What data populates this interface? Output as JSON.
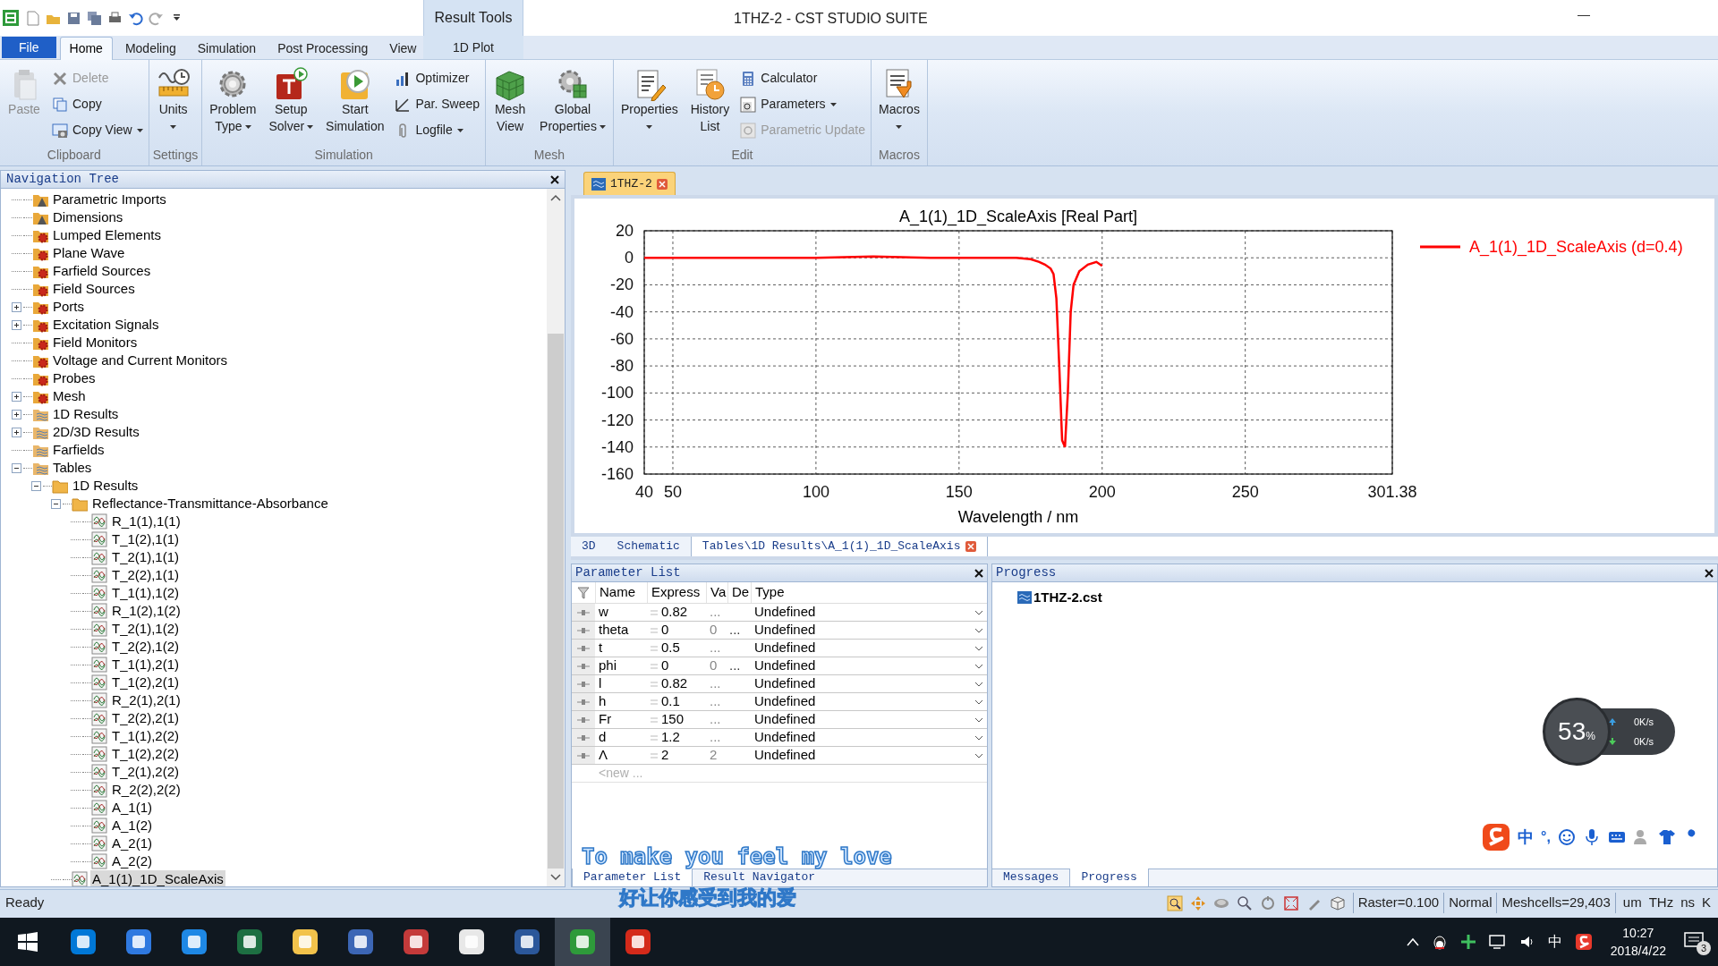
{
  "window": {
    "title": "1THZ-2 - CST STUDIO SUITE",
    "context_tab": "Result Tools",
    "minimize": "—"
  },
  "ribbon_tabs": [
    {
      "label": "File",
      "selected": false,
      "kind": "file"
    },
    {
      "label": "Home",
      "selected": true,
      "kind": "tab"
    },
    {
      "label": "Modeling",
      "selected": false,
      "kind": "tab"
    },
    {
      "label": "Simulation",
      "selected": false,
      "kind": "tab"
    },
    {
      "label": "Post Processing",
      "selected": false,
      "kind": "tab"
    },
    {
      "label": "View",
      "selected": false,
      "kind": "tab"
    },
    {
      "label": "1D Plot",
      "selected": false,
      "kind": "context"
    }
  ],
  "ribbon_groups": [
    {
      "label": "Clipboard",
      "items": [
        {
          "kind": "large",
          "lines": [
            "Paste"
          ],
          "disabled": true,
          "dropdown": false
        },
        {
          "kind": "stack",
          "items": [
            {
              "label": "Delete",
              "disabled": true,
              "dropdown": false
            },
            {
              "label": "Copy",
              "disabled": false,
              "dropdown": false
            },
            {
              "label": "Copy View",
              "disabled": false,
              "dropdown": true
            }
          ]
        }
      ]
    },
    {
      "label": "Settings",
      "items": [
        {
          "kind": "large",
          "lines": [
            "Units"
          ],
          "disabled": false,
          "dropdown": true
        }
      ]
    },
    {
      "label": "Simulation",
      "items": [
        {
          "kind": "large",
          "lines": [
            "Problem",
            "Type"
          ],
          "disabled": false,
          "dropdown": true
        },
        {
          "kind": "large",
          "lines": [
            "Setup",
            "Solver"
          ],
          "disabled": false,
          "dropdown": true
        },
        {
          "kind": "large",
          "lines": [
            "Start",
            "Simulation"
          ],
          "disabled": false,
          "dropdown": false
        },
        {
          "kind": "stack",
          "items": [
            {
              "label": "Optimizer",
              "disabled": false,
              "dropdown": false
            },
            {
              "label": "Par. Sweep",
              "disabled": false,
              "dropdown": false
            },
            {
              "label": "Logfile",
              "disabled": false,
              "dropdown": true
            }
          ]
        }
      ]
    },
    {
      "label": "Mesh",
      "items": [
        {
          "kind": "large",
          "lines": [
            "Mesh",
            "View"
          ],
          "disabled": false,
          "dropdown": false
        },
        {
          "kind": "large",
          "lines": [
            "Global",
            "Properties"
          ],
          "disabled": false,
          "dropdown": true
        }
      ]
    },
    {
      "label": "Edit",
      "items": [
        {
          "kind": "large",
          "lines": [
            "Properties"
          ],
          "disabled": false,
          "dropdown": true
        },
        {
          "kind": "large",
          "lines": [
            "History",
            "List"
          ],
          "disabled": false,
          "dropdown": false
        },
        {
          "kind": "stack",
          "items": [
            {
              "label": "Calculator",
              "disabled": false,
              "dropdown": false
            },
            {
              "label": "Parameters",
              "disabled": false,
              "dropdown": true
            },
            {
              "label": "Parametric Update",
              "disabled": true,
              "dropdown": false
            }
          ]
        }
      ]
    },
    {
      "label": "Macros",
      "items": [
        {
          "kind": "large",
          "lines": [
            "Macros"
          ],
          "disabled": false,
          "dropdown": true
        }
      ]
    }
  ],
  "navigation_tree": {
    "title": "Navigation Tree",
    "items": [
      {
        "label": "Parametric Imports",
        "kind": "parameter",
        "selected": false
      },
      {
        "label": "Dimensions",
        "kind": "parameter",
        "selected": false
      },
      {
        "label": "Lumped Elements",
        "kind": "component",
        "selected": false
      },
      {
        "label": "Plane Wave",
        "kind": "component",
        "selected": false
      },
      {
        "label": "Farfield Sources",
        "kind": "component",
        "selected": false
      },
      {
        "label": "Field Sources",
        "kind": "component",
        "selected": false
      },
      {
        "label": "Ports",
        "kind": "component",
        "selected": false,
        "expanded": false
      },
      {
        "label": "Excitation Signals",
        "kind": "component",
        "selected": false,
        "expanded": false
      },
      {
        "label": "Field Monitors",
        "kind": "component",
        "selected": false
      },
      {
        "label": "Voltage and Current Monitors",
        "kind": "component",
        "selected": false
      },
      {
        "label": "Probes",
        "kind": "component",
        "selected": false
      },
      {
        "label": "Mesh",
        "kind": "component",
        "selected": false,
        "expanded": false
      },
      {
        "label": "1D Results",
        "kind": "result",
        "selected": false,
        "expanded": false
      },
      {
        "label": "2D/3D Results",
        "kind": "result",
        "selected": false,
        "expanded": false
      },
      {
        "label": "Farfields",
        "kind": "result",
        "selected": false
      },
      {
        "label": "Tables",
        "kind": "result",
        "selected": false,
        "expanded": true,
        "children": [
          {
            "label": "1D Results",
            "kind": "folder",
            "selected": false,
            "expanded": true,
            "children": [
              {
                "label": "Reflectance-Transmittance-Absorbance",
                "kind": "folder",
                "selected": false,
                "expanded": true,
                "children": [
                  {
                    "label": "R_1(1),1(1)",
                    "kind": "curve",
                    "selected": false
                  },
                  {
                    "label": "T_1(2),1(1)",
                    "kind": "curve",
                    "selected": false
                  },
                  {
                    "label": "T_2(1),1(1)",
                    "kind": "curve",
                    "selected": false
                  },
                  {
                    "label": "T_2(2),1(1)",
                    "kind": "curve",
                    "selected": false
                  },
                  {
                    "label": "T_1(1),1(2)",
                    "kind": "curve",
                    "selected": false
                  },
                  {
                    "label": "R_1(2),1(2)",
                    "kind": "curve",
                    "selected": false
                  },
                  {
                    "label": "T_2(1),1(2)",
                    "kind": "curve",
                    "selected": false
                  },
                  {
                    "label": "T_2(2),1(2)",
                    "kind": "curve",
                    "selected": false
                  },
                  {
                    "label": "T_1(1),2(1)",
                    "kind": "curve",
                    "selected": false
                  },
                  {
                    "label": "T_1(2),2(1)",
                    "kind": "curve",
                    "selected": false
                  },
                  {
                    "label": "R_2(1),2(1)",
                    "kind": "curve",
                    "selected": false
                  },
                  {
                    "label": "T_2(2),2(1)",
                    "kind": "curve",
                    "selected": false
                  },
                  {
                    "label": "T_1(1),2(2)",
                    "kind": "curve",
                    "selected": false
                  },
                  {
                    "label": "T_1(2),2(2)",
                    "kind": "curve",
                    "selected": false
                  },
                  {
                    "label": "T_2(1),2(2)",
                    "kind": "curve",
                    "selected": false
                  },
                  {
                    "label": "R_2(2),2(2)",
                    "kind": "curve",
                    "selected": false
                  },
                  {
                    "label": "A_1(1)",
                    "kind": "curve",
                    "selected": false
                  },
                  {
                    "label": "A_1(2)",
                    "kind": "curve",
                    "selected": false
                  },
                  {
                    "label": "A_2(1)",
                    "kind": "curve",
                    "selected": false
                  },
                  {
                    "label": "A_2(2)",
                    "kind": "curve",
                    "selected": false
                  }
                ]
              },
              {
                "label": "A_1(1)_1D_ScaleAxis",
                "kind": "curve",
                "selected": true
              }
            ]
          }
        ]
      }
    ]
  },
  "document_tab": {
    "label": "1THZ-2"
  },
  "plot": {
    "chart_data": {
      "type": "line",
      "title": "A_1(1)_1D_ScaleAxis [Real Part]",
      "xlabel": "Wavelength / nm",
      "x": [
        40,
        60,
        80,
        100,
        120,
        140,
        160,
        170,
        175,
        178,
        180,
        182,
        183,
        184,
        185,
        186,
        187,
        188,
        189,
        190,
        192,
        195,
        198,
        200
      ],
      "series": [
        {
          "name": "A_1(1)_1D_ScaleAxis (d=0.4)",
          "color": "#ff0000",
          "values": [
            0,
            0,
            0,
            0,
            1,
            0,
            0,
            0,
            -1,
            -3,
            -5,
            -8,
            -12,
            -30,
            -80,
            -135,
            -140,
            -100,
            -40,
            -20,
            -10,
            -5,
            -3,
            -6
          ]
        }
      ],
      "xlim": [
        40,
        301.38
      ],
      "ylim": [
        -160,
        20
      ],
      "xticks": [
        40,
        50,
        100,
        150,
        200,
        250,
        301.38
      ],
      "yticks": [
        20,
        0,
        -20,
        -40,
        -60,
        -80,
        -100,
        -120,
        -140,
        -160
      ],
      "grid": true
    }
  },
  "view_tabs": [
    {
      "label": "3D",
      "selected": false,
      "closable": false
    },
    {
      "label": "Schematic",
      "selected": false,
      "closable": false
    },
    {
      "label": "Tables\\1D Results\\A_1(1)_1D_ScaleAxis",
      "selected": true,
      "closable": true
    }
  ],
  "parameter_list": {
    "title": "Parameter List",
    "columns": [
      "Name",
      "Express",
      "Va",
      "De",
      "Type"
    ],
    "rows": [
      {
        "name": "w",
        "expression": "0.82",
        "value": "...",
        "type": "Undefined"
      },
      {
        "name": "theta",
        "expression": "0",
        "value": "0",
        "description": "...",
        "type": "Undefined"
      },
      {
        "name": "t",
        "expression": "0.5",
        "value": "...",
        "type": "Undefined"
      },
      {
        "name": "phi",
        "expression": "0",
        "value": "0",
        "description": "...",
        "type": "Undefined"
      },
      {
        "name": "l",
        "expression": "0.82",
        "value": "...",
        "type": "Undefined"
      },
      {
        "name": "h",
        "expression": "0.1",
        "value": "...",
        "type": "Undefined"
      },
      {
        "name": "Fr",
        "expression": "150",
        "value": "...",
        "type": "Undefined"
      },
      {
        "name": "d",
        "expression": "1.2",
        "value": "...",
        "type": "Undefined"
      },
      {
        "name": "Λ",
        "expression": "2",
        "value": "2",
        "type": "Undefined"
      }
    ],
    "new_row_placeholder": "<new ...",
    "tabs": [
      {
        "label": "Parameter List",
        "selected": true
      },
      {
        "label": "Result Navigator",
        "selected": false
      }
    ]
  },
  "progress": {
    "title": "Progress",
    "file": "1THZ-2.cst",
    "tabs": [
      {
        "label": "Messages",
        "selected": false
      },
      {
        "label": "Progress",
        "selected": true
      }
    ]
  },
  "speed_widget": {
    "percent": "53",
    "unit": "%",
    "upload": "0K/s",
    "download": "0K/s"
  },
  "ime_toolbar": {
    "mode": "中",
    "punct": "°,"
  },
  "lyrics": {
    "line_1": "To make you feel my love",
    "line_2": "好让你感受到我的爱"
  },
  "status_bar": {
    "text": "Ready",
    "fields": [
      "Raster=0.100",
      "Normal",
      "Meshcells=29,403"
    ],
    "units": [
      "um",
      "THz",
      "ns",
      "K"
    ]
  },
  "taskbar": {
    "ime": "中",
    "time": "10:27",
    "date": "2018/4/22",
    "notifications": "3"
  }
}
